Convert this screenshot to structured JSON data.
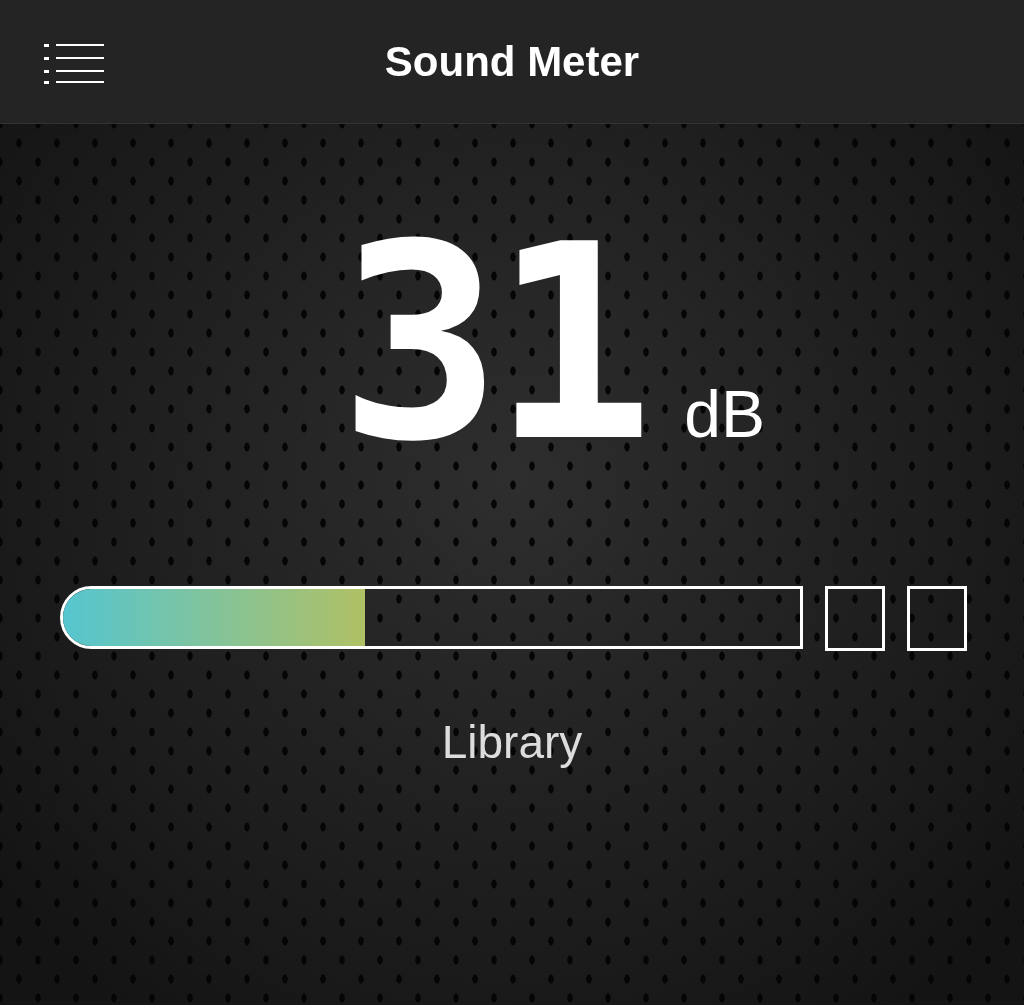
{
  "header": {
    "title": "Sound Meter"
  },
  "reading": {
    "value": "31",
    "unit": "dB"
  },
  "meter": {
    "level": 0.41,
    "peaks": [
      {
        "lit": false
      },
      {
        "lit": false
      }
    ]
  },
  "environment": "Library"
}
